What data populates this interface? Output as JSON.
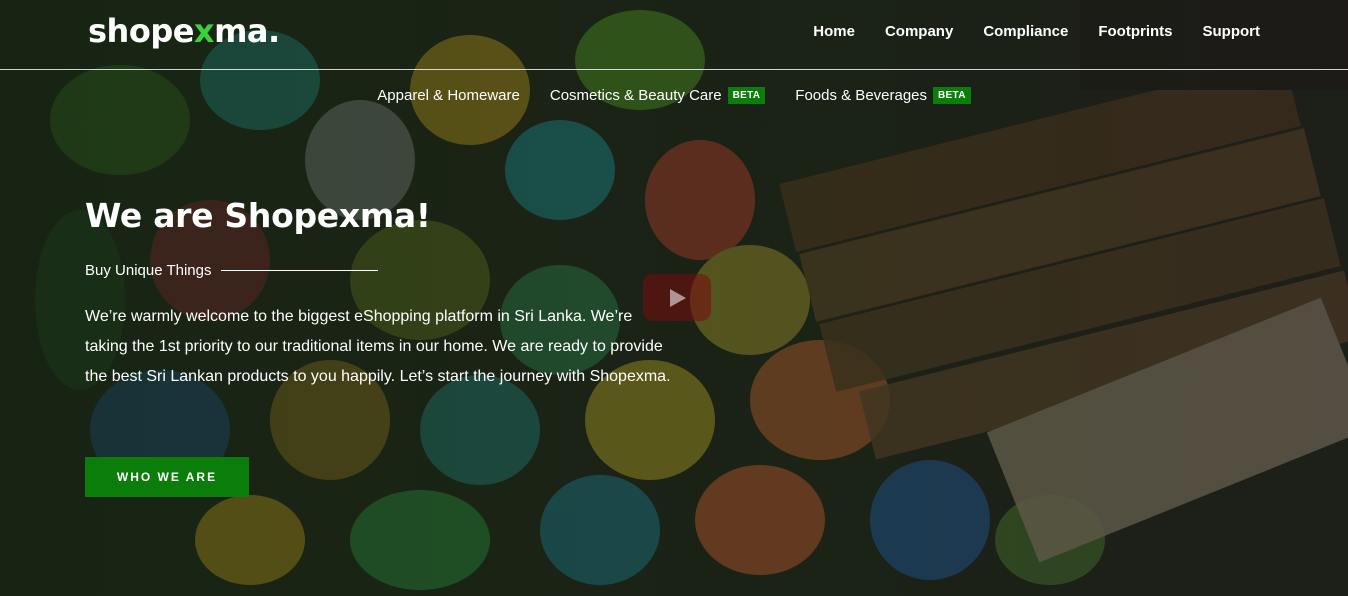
{
  "brand": {
    "name_main": "shope",
    "name_accent": "x",
    "name_end": "ma."
  },
  "main_nav": [
    {
      "label": "Home"
    },
    {
      "label": "Company"
    },
    {
      "label": "Compliance"
    },
    {
      "label": "Footprints"
    },
    {
      "label": "Support"
    }
  ],
  "sub_nav": [
    {
      "label": "Apparel & Homeware"
    },
    {
      "label": "Cosmetics & Beauty Care",
      "badge": "BETA"
    },
    {
      "label": "Foods & Beverages",
      "badge": "BETA"
    }
  ],
  "hero": {
    "title": "We are Shopexma!",
    "tagline": "Buy Unique Things",
    "intro": "We’re warmly welcome to the biggest eShopping platform in Sri Lanka. We’re taking the 1st priority to our traditional items in our home. We are ready to provide the best Sri Lankan products to you happily. Let’s start the journey with Shopexma.",
    "cta_label": "WHO WE ARE"
  },
  "icons": {
    "play": "play-icon"
  },
  "colors": {
    "accent_green": "#0a7d0a",
    "logo_accent": "#3ad13a",
    "play_red": "#780c0c"
  }
}
